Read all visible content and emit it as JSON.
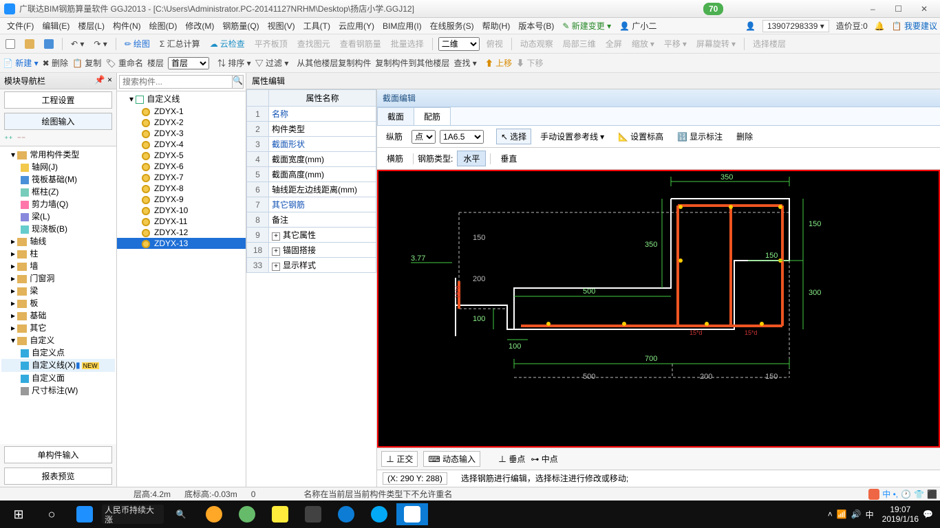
{
  "title": "广联达BIM钢筋算量软件 GGJ2013 - [C:\\Users\\Administrator.PC-20141127NRHM\\Desktop\\扬店小学.GGJ12]",
  "badge": "70",
  "winbtns": {
    "min": "–",
    "max": "☐",
    "close": "✕"
  },
  "menus": [
    "文件(F)",
    "编辑(E)",
    "楼层(L)",
    "构件(N)",
    "绘图(D)",
    "修改(M)",
    "钢筋量(Q)",
    "视图(V)",
    "工具(T)",
    "云应用(Y)",
    "BIM应用(I)",
    "在线服务(S)",
    "帮助(H)",
    "版本号(B)"
  ],
  "menu_right": {
    "newchange": "新建变更",
    "avatar": "广小二",
    "phone": "13907298339",
    "price": "造价豆:0",
    "suggest": "我要建议"
  },
  "toolbar1": {
    "draw": "绘图",
    "sum": "Σ 汇总计算",
    "cloud": "云检查",
    "flat": "平齐板顶",
    "viewfind": "查找图元",
    "viewsteel": "查看钢筋量",
    "batch": "批量选择",
    "dim2d": "二维",
    "bird": "俯视",
    "dyn": "动态观察",
    "local3d": "局部三维",
    "full": "全屏",
    "zoom": "缩放",
    "pan": "平移",
    "rot": "屏幕旋转",
    "selfloor": "选择楼层"
  },
  "toolbar2": {
    "new": "新建",
    "del": "删除",
    "copy": "复制",
    "rename": "重命名",
    "floor": "楼层",
    "firstfloor": "首层",
    "sort": "排序",
    "filter": "过滤",
    "copyfrom": "从其他楼层复制构件",
    "copyto": "复制构件到其他楼层",
    "find": "查找",
    "up": "上移",
    "down": "下移"
  },
  "nav": {
    "title": "模块导航栏",
    "eng": "工程设置",
    "drawin": "绘图输入",
    "groups": [
      {
        "label": "常用构件类型",
        "items": [
          {
            "l": "轴网(J)"
          },
          {
            "l": "筏板基础(M)"
          },
          {
            "l": "框柱(Z)"
          },
          {
            "l": "剪力墙(Q)"
          },
          {
            "l": "梁(L)"
          },
          {
            "l": "现浇板(B)"
          }
        ]
      },
      {
        "label": "轴线"
      },
      {
        "label": "柱"
      },
      {
        "label": "墙"
      },
      {
        "label": "门窗洞"
      },
      {
        "label": "梁"
      },
      {
        "label": "板"
      },
      {
        "label": "基础"
      },
      {
        "label": "其它"
      },
      {
        "label": "自定义",
        "items": [
          {
            "l": "自定义点"
          },
          {
            "l": "自定义线(X)",
            "hl": true,
            "new": true
          },
          {
            "l": "自定义面"
          },
          {
            "l": "尺寸标注(W)"
          }
        ]
      }
    ],
    "single": "单构件输入",
    "report": "报表预览"
  },
  "complist": {
    "search": "搜索构件...",
    "group": "自定义线",
    "items": [
      "ZDYX-1",
      "ZDYX-2",
      "ZDYX-3",
      "ZDYX-4",
      "ZDYX-5",
      "ZDYX-6",
      "ZDYX-7",
      "ZDYX-8",
      "ZDYX-9",
      "ZDYX-10",
      "ZDYX-11",
      "ZDYX-12",
      "ZDYX-13"
    ],
    "selected": "ZDYX-13"
  },
  "props": {
    "title": "属性编辑",
    "colhead": "属性名称",
    "rows": [
      {
        "n": "1",
        "l": "名称",
        "blue": true
      },
      {
        "n": "2",
        "l": "构件类型"
      },
      {
        "n": "3",
        "l": "截面形状",
        "blue": true
      },
      {
        "n": "4",
        "l": "截面宽度(mm)"
      },
      {
        "n": "5",
        "l": "截面高度(mm)"
      },
      {
        "n": "6",
        "l": "轴线距左边线距离(mm)"
      },
      {
        "n": "7",
        "l": "其它钢筋",
        "blue": true
      },
      {
        "n": "8",
        "l": "备注"
      },
      {
        "n": "9",
        "l": "其它属性",
        "plus": true
      },
      {
        "n": "18",
        "l": "锚固搭接",
        "plus": true
      },
      {
        "n": "33",
        "l": "显示样式",
        "plus": true
      }
    ]
  },
  "editor": {
    "head": "截面编辑",
    "tab1": "截面",
    "tab2": "配筋",
    "row1": {
      "zong": "纵筋",
      "dian": "点",
      "spec": "1A6.5",
      "select": "选择",
      "manual": "手动设置参考线",
      "origin": "设置标高",
      "show": "显示标注",
      "del": "删除"
    },
    "row2": {
      "heng": "横筋",
      "type": "钢筋类型:",
      "shui": "水平",
      "chui": "垂直"
    },
    "bottom": {
      "ortho": "正交",
      "dyn": "动态输入",
      "vert": "垂点",
      "mid": "中点"
    },
    "coord": "(X: 290 Y: 288)",
    "hint": "选择钢筋进行编辑，选择标注进行修改或移动;"
  },
  "status": {
    "floor": "层高:4.2m",
    "base": "底标高:-0.03m",
    "o": "0",
    "msg": "名称在当前层当前构件类型下不允许重名"
  },
  "dims": {
    "d350": "350",
    "d150": "150",
    "d300": "300",
    "d100": "100",
    "d200": "200",
    "d500": "500",
    "d700": "700",
    "d377": "3.77"
  },
  "tray": {
    "time": "19:07",
    "date": "2019/1/16",
    "ime": "中"
  },
  "news": "人民币持续大涨"
}
